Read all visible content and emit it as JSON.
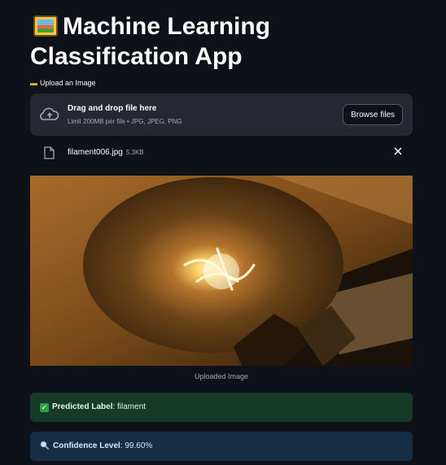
{
  "app": {
    "title": "Machine Learning Classification App",
    "title_icon": "framed-picture-icon"
  },
  "uploader": {
    "label_icon": "folder-icon",
    "label": "Upload an Image",
    "drop_title": "Drag and drop file here",
    "drop_subtitle": "Limit 200MB per file • JPG, JPEG, PNG",
    "browse_label": "Browse files"
  },
  "uploaded_file": {
    "name": "filament006.jpg",
    "size": "5.3KB"
  },
  "image": {
    "caption": "Uploaded Image"
  },
  "results": {
    "predicted_prefix": "Predicted Label",
    "predicted_value": ": filament",
    "confidence_prefix": "Confidence Level",
    "confidence_value": ": 99.60%"
  },
  "colors": {
    "background": "#0e1117",
    "dropzone": "#262730",
    "success_bg": "#173928",
    "info_bg": "#172d43"
  }
}
